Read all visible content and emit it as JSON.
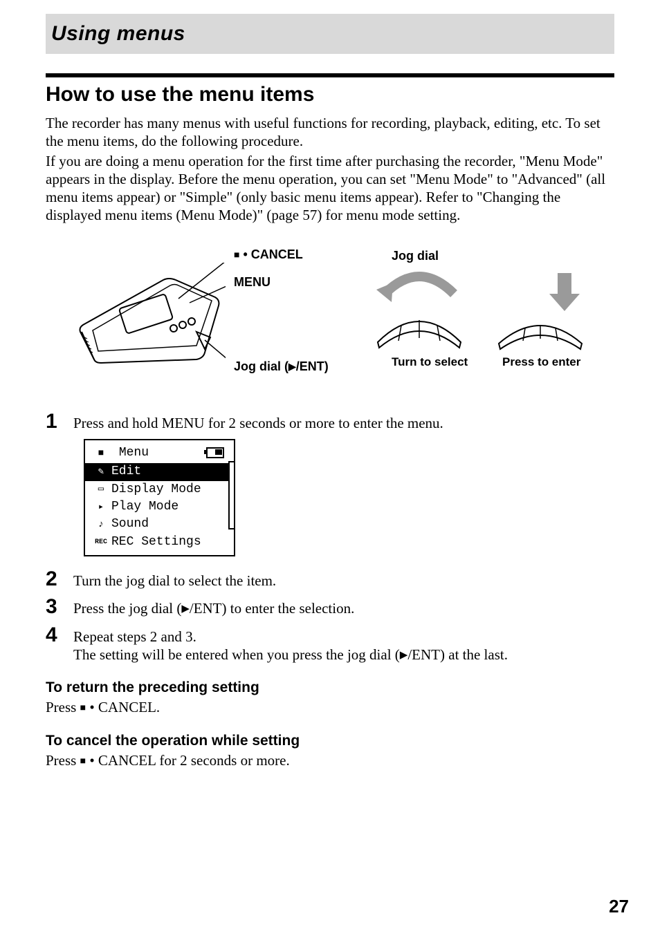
{
  "chapter": "Using menus",
  "section_title": "How to use the menu items",
  "intro_para_1": "The recorder has many menus with useful functions for recording, playback, editing, etc. To set the menu items, do the following procedure.",
  "intro_para_2": "If you are doing a menu operation for the first time after purchasing the recorder, \"Menu Mode\" appears in the display. Before the menu operation, you can set \"Menu Mode\" to \"Advanced\" (all menu items appear) or \"Simple\" (only basic menu items appear). Refer to \"Changing the displayed menu items (Menu Mode)\" (page 57) for menu mode setting.",
  "diagram": {
    "cancel_label_prefix": "■ • ",
    "cancel_label": "CANCEL",
    "menu_label": "MENU",
    "jogdial_label_prefix": "Jog dial (",
    "jogdial_label_suffix": "/ENT)",
    "jogdial_heading": "Jog dial",
    "turn_label": "Turn to select",
    "press_label": "Press to enter"
  },
  "steps": [
    {
      "num": "1",
      "text": "Press and hold MENU for 2 seconds or more to enter the menu."
    },
    {
      "num": "2",
      "text": "Turn the jog dial to select the item."
    },
    {
      "num": "3",
      "text_a": "Press the jog dial (",
      "text_b": "/ENT) to enter the selection."
    },
    {
      "num": "4",
      "text": "Repeat steps 2 and 3.",
      "text2_a": "The setting will be entered when you press the jog dial (",
      "text2_b": "/ENT) at the last."
    }
  ],
  "lcd": {
    "title": "Menu",
    "items": [
      {
        "icon": "edit",
        "label": "Edit",
        "selected": true
      },
      {
        "icon": "display",
        "label": "Display Mode",
        "selected": false
      },
      {
        "icon": "play",
        "label": "Play Mode",
        "selected": false
      },
      {
        "icon": "sound",
        "label": "Sound",
        "selected": false
      },
      {
        "icon": "rec",
        "label": "REC Settings",
        "selected": false
      }
    ]
  },
  "return_heading": "To return the preceding setting",
  "return_body_a": "Press ",
  "return_body_b": " • CANCEL.",
  "cancelop_heading": "To cancel the operation while setting",
  "cancelop_body_a": "Press ",
  "cancelop_body_b": " • CANCEL for 2 seconds or more.",
  "page_number": "27"
}
